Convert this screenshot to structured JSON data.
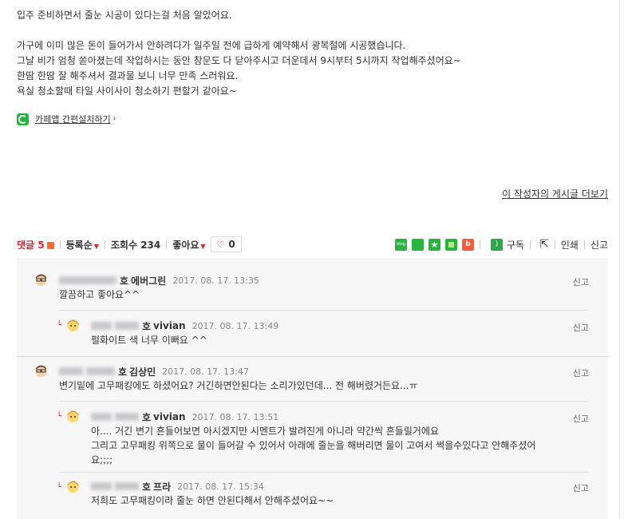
{
  "post": {
    "lines": [
      "입주 준비하면서 줄눈 시공이 있다는걸 처음 알았어요.",
      "",
      "가구에 이미 많은 돈이 들어가서 안하려다가 일주일 전에 급하게 예약해서 광복절에 시공했습니다.",
      "그날 비가 엄청 쏟아졌는데 작업하시는 동안 창문도 다 닫아주시고 더운데서 9시부터 5시까지 작업해주셨어요~",
      "한땀 한땀 잘 해주셔서 결과물 보니 너무 만족 스러워요.",
      "욕실 청소할때 타일 사이사이 청소하기 편할거 같아요~"
    ],
    "cafe_app_link": "카페앱 간편설치하기",
    "more_by_author": "이 작성자의 게시글 더보기"
  },
  "toolbar": {
    "comments_label": "댓글 5",
    "sort_label": "등록순",
    "views_label": "조회수 234",
    "like_label": "좋아요",
    "like_count": "0",
    "subscribe_label": "구독",
    "print_label": "인쇄",
    "report_label": "신고"
  },
  "comments": [
    {
      "hosu": "호",
      "nick": "에버그린",
      "date": "2017. 08. 17.  13:35",
      "body": "깔끔하고 좋아요^^",
      "report": "신고"
    },
    {
      "hosu": "호",
      "nick": "vivian",
      "date": "2017. 08. 17.  13:49",
      "body": "펄화이트 색 너무 이뻐요 ^^",
      "report": "신고"
    },
    {
      "hosu": "호",
      "nick": "김상민",
      "date": "2017. 08. 17.  13:47",
      "body": "변기밑에 고무패킹에도 하셨어요? 거긴하면안된다는 소리가있던데... 전 해버렸거든요...ㅠ",
      "report": "신고"
    },
    {
      "hosu": "호",
      "nick": "vivian",
      "date": "2017. 08. 17.  13:51",
      "body": "아.... 거긴 변기 흔들어보면 아시겠지만 시멘트가 발려진게 아니라 약간씩 흔들릴거에요",
      "body2": "그리고 고무패킹 위쪽으로 물이 들어갈 수 있어서 아래에 줄눈을 해버리면 물이 고여서 썩을수있다고 안해주셨어",
      "body3": "요;;;;",
      "report": "신고"
    },
    {
      "hosu": "호",
      "nick": "프라",
      "date": "2017. 08. 17.  15:34",
      "body": "저희도 고무패킹이라 줄눈 하면 안된다해서 안해주셨어요~~",
      "report": "신고"
    }
  ],
  "colors": {
    "accent": "#e0252f",
    "naver_green": "#28b43f",
    "comment_bg": "#f7f7f7"
  }
}
